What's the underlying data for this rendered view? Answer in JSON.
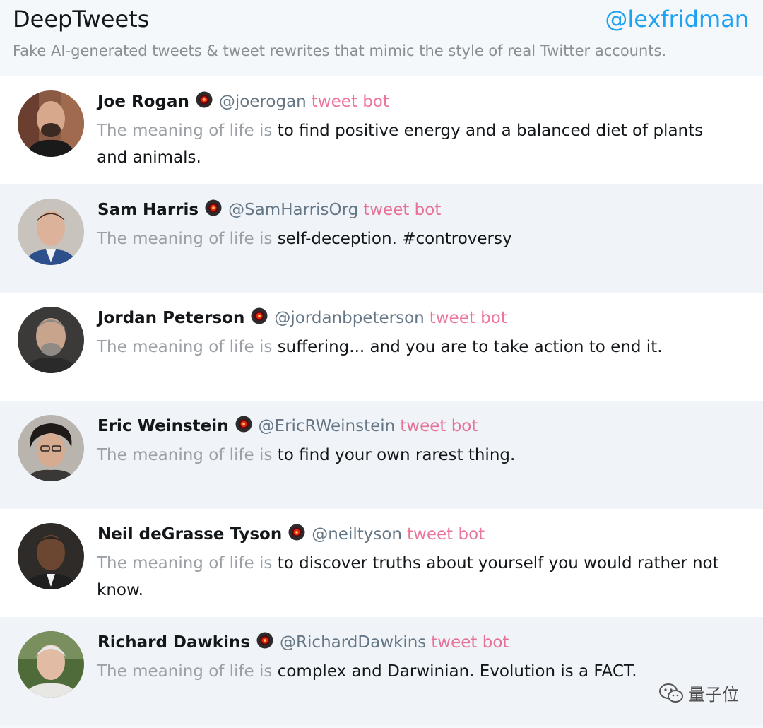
{
  "header": {
    "brand": "DeepTweets",
    "author_handle": "@lexfridman",
    "tagline": "Fake AI-generated tweets & tweet rewrites that mimic the style of real Twitter accounts."
  },
  "bot_label": "tweet bot",
  "prompt": "The meaning of life is",
  "tweets": [
    {
      "name": "Joe Rogan",
      "handle": "@joerogan",
      "completion": "to find positive energy and a balanced diet of plants and animals."
    },
    {
      "name": "Sam Harris",
      "handle": "@SamHarrisOrg",
      "completion": "self-deception. #controversy"
    },
    {
      "name": "Jordan Peterson",
      "handle": "@jordanbpeterson",
      "completion": "suffering... and you are to take action to end it."
    },
    {
      "name": "Eric Weinstein",
      "handle": "@EricRWeinstein",
      "completion": "to find your own rarest thing."
    },
    {
      "name": "Neil deGrasse Tyson",
      "handle": "@neiltyson",
      "completion": "to discover truths about yourself you would rather not know."
    },
    {
      "name": "Richard Dawkins",
      "handle": "@RichardDawkins",
      "completion": "complex and Darwinian. Evolution is a FACT."
    }
  ],
  "watermark": "量子位",
  "icons": {
    "bot": "hal-9000-eye-icon",
    "watermark": "wechat-icon"
  },
  "colors": {
    "accent": "#1da1f2",
    "bot_label": "#e0245e",
    "prompt": "#9aa0a6"
  }
}
